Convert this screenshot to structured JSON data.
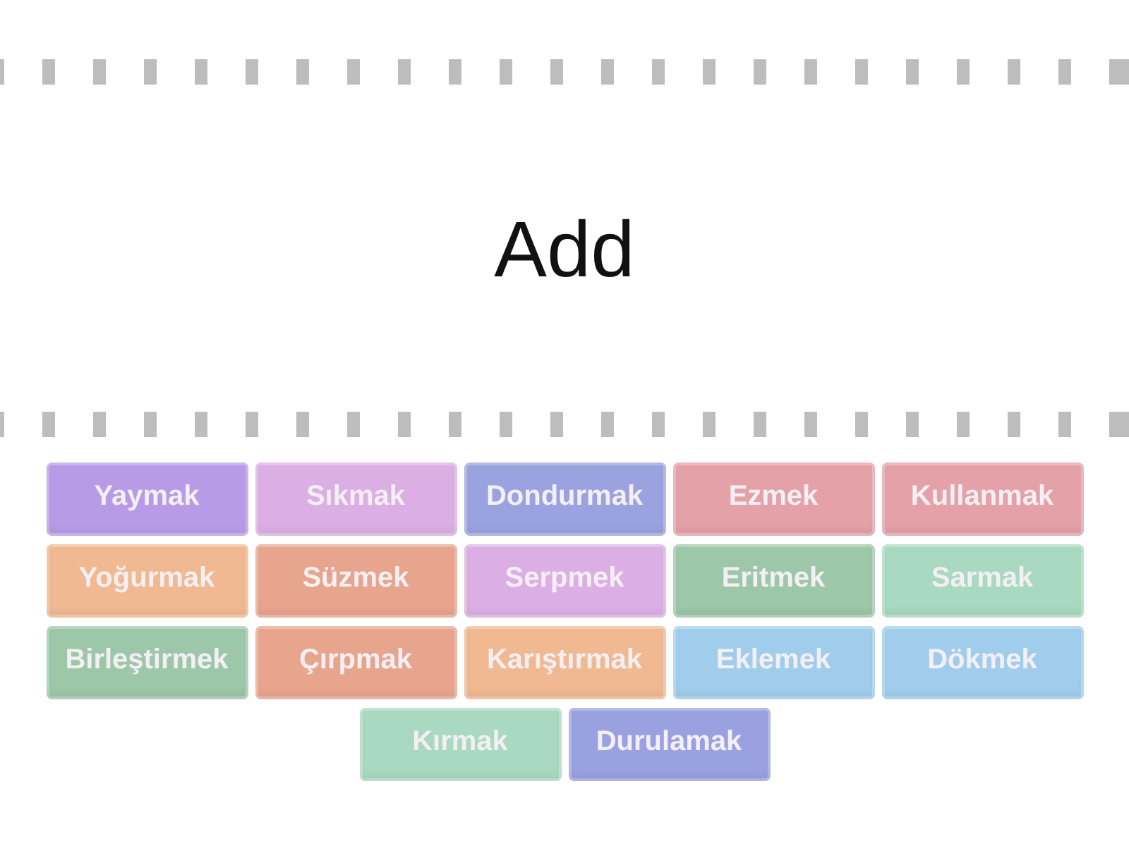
{
  "prompt": {
    "text": "Add"
  },
  "cards": [
    {
      "text": "Yaymak",
      "color": "#b89be6"
    },
    {
      "text": "Sıkmak",
      "color": "#dcafe4"
    },
    {
      "text": "Dondurmak",
      "color": "#9aa3e0"
    },
    {
      "text": "Ezmek",
      "color": "#e4a1a8"
    },
    {
      "text": "Kullanmak",
      "color": "#e4a1a8"
    },
    {
      "text": "Yoğurmak",
      "color": "#f0b991"
    },
    {
      "text": "Süzmek",
      "color": "#e8a58e"
    },
    {
      "text": "Serpmek",
      "color": "#dcafe4"
    },
    {
      "text": "Eritmek",
      "color": "#9dc7a9"
    },
    {
      "text": "Sarmak",
      "color": "#a9d9c1"
    },
    {
      "text": "Birleştirmek",
      "color": "#9dc7a9"
    },
    {
      "text": "Çırpmak",
      "color": "#e8a58e"
    },
    {
      "text": "Karıştırmak",
      "color": "#f0b991"
    },
    {
      "text": "Eklemek",
      "color": "#a1cdec"
    },
    {
      "text": "Dökmek",
      "color": "#a1cdec"
    },
    {
      "text": "Kırmak",
      "color": "#a9d9c1"
    },
    {
      "text": "Durulamak",
      "color": "#9aa1e0"
    }
  ]
}
